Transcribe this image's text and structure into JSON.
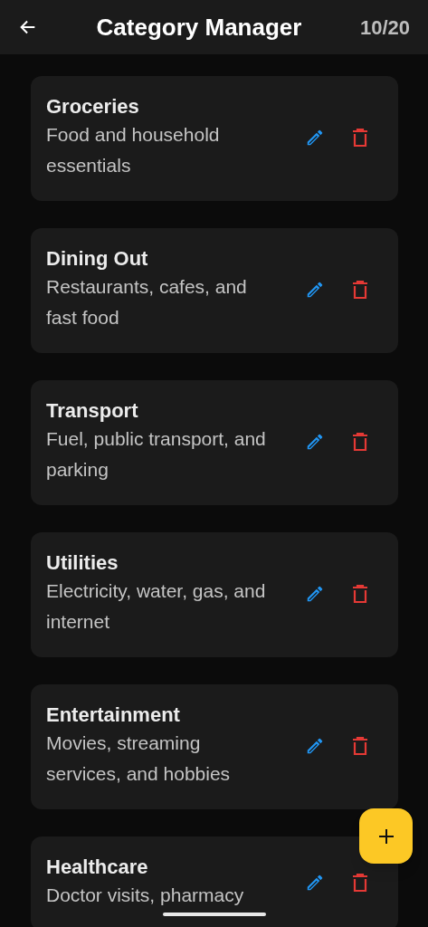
{
  "app_bar": {
    "title": "Category Manager",
    "counter": "10/20"
  },
  "categories": [
    {
      "name": "Groceries",
      "description": "Food and household essentials"
    },
    {
      "name": "Dining Out",
      "description": "Restaurants, cafes, and fast food"
    },
    {
      "name": "Transport",
      "description": "Fuel, public transport, and parking"
    },
    {
      "name": "Utilities",
      "description": "Electricity, water, gas, and internet"
    },
    {
      "name": "Entertainment",
      "description": "Movies, streaming services, and hobbies"
    },
    {
      "name": "Healthcare",
      "description": "Doctor visits, pharmacy"
    }
  ]
}
